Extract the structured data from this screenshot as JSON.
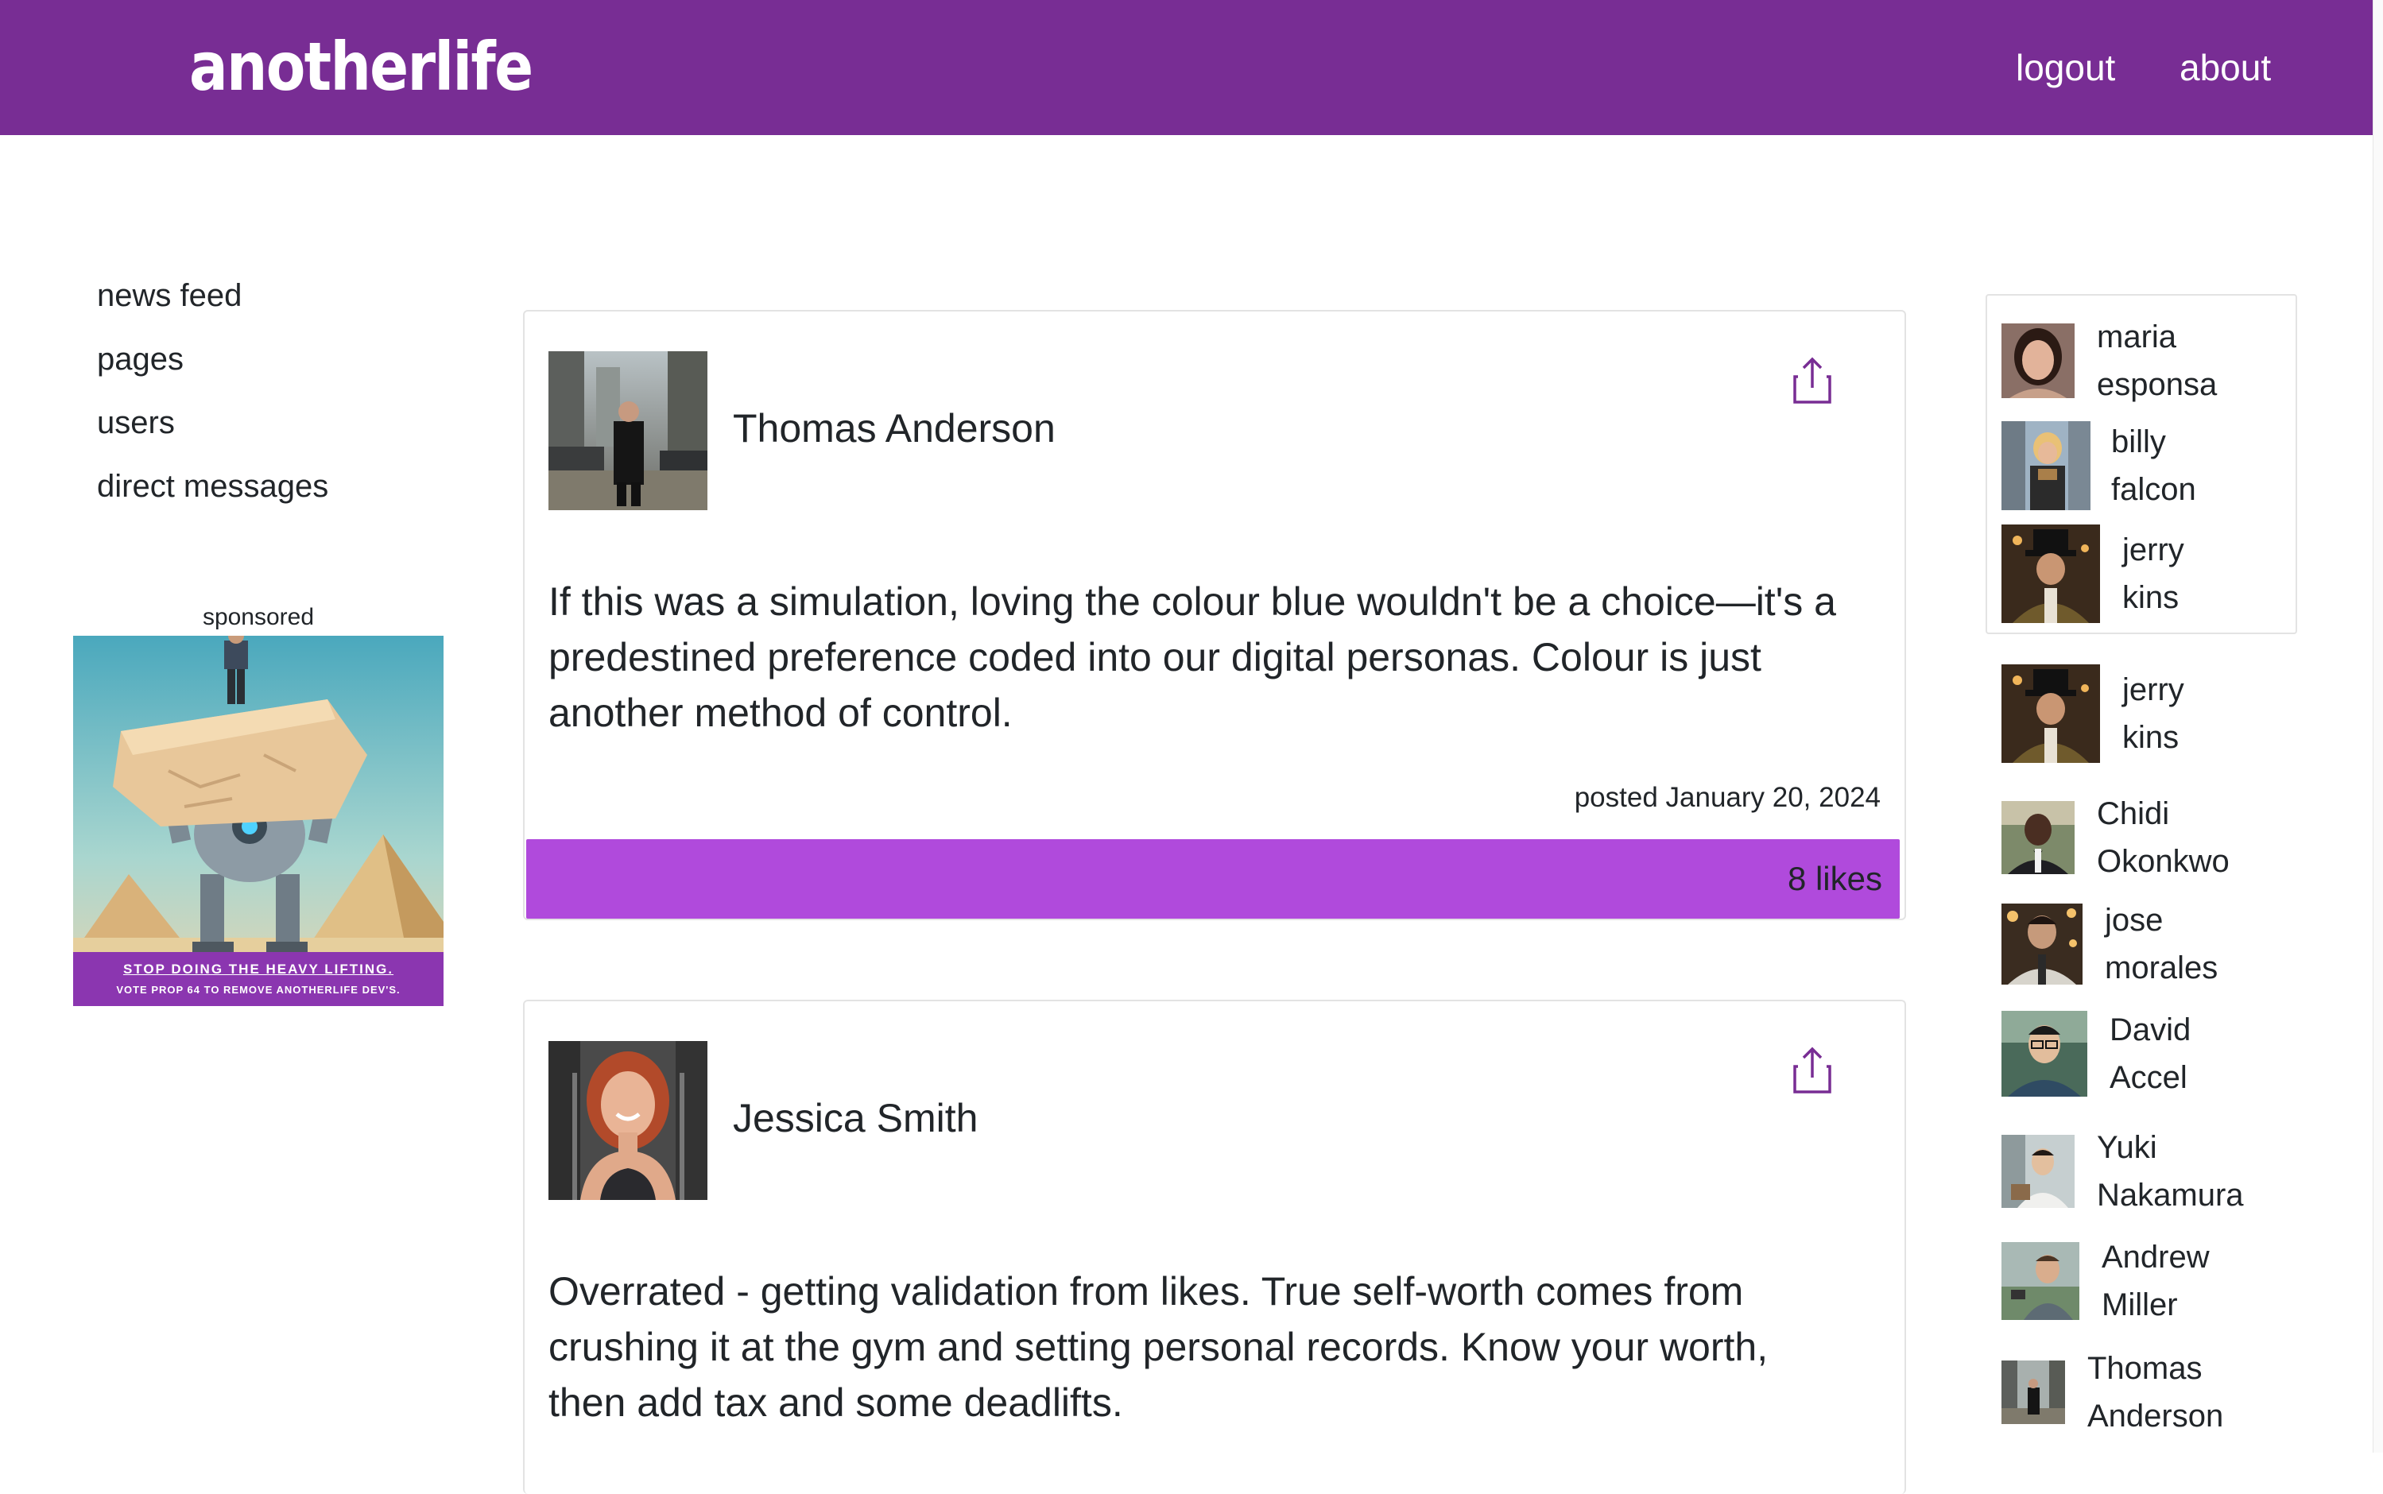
{
  "header": {
    "brand": "anotherlife",
    "logout_label": "logout",
    "about_label": "about",
    "color": "#782d94"
  },
  "sidebar": {
    "items": [
      {
        "label": "news feed"
      },
      {
        "label": "pages"
      },
      {
        "label": "users"
      },
      {
        "label": "direct messages"
      }
    ],
    "sponsored_label": "sponsored",
    "ad": {
      "line1": "STOP DOING THE HEAVY LIFTING.",
      "line2": "VOTE PROP 64 TO REMOVE ANOTHERLIFE DEV'S."
    }
  },
  "posts": [
    {
      "author": "Thomas Anderson",
      "text": "If this was a simulation, loving the colour blue wouldn't be a choice—it's a predestined preference coded into our digital personas. Colour is just another method of control.",
      "date": "posted January 20, 2024",
      "likes": "8 likes"
    },
    {
      "author": "Jessica Smith",
      "text": "Overrated - getting validation from likes. True self-worth comes from crushing it at the gym and setting personal records. Know your worth, then add tax and some deadlifts."
    }
  ],
  "users_online": [
    {
      "first": "maria",
      "last": "esponsa"
    },
    {
      "first": "billy",
      "last": "falcon"
    },
    {
      "first": "jerry",
      "last": "kins"
    }
  ],
  "users": [
    {
      "first": "jerry",
      "last": "kins"
    },
    {
      "first": "Chidi",
      "last": "Okonkwo"
    },
    {
      "first": "jose",
      "last": "morales"
    },
    {
      "first": "David",
      "last": "Accel"
    },
    {
      "first": "Yuki",
      "last": "Nakamura"
    },
    {
      "first": "Andrew",
      "last": "Miller"
    },
    {
      "first": "Thomas",
      "last": "Anderson"
    }
  ],
  "accent_colors": {
    "header": "#782d94",
    "likes_bar": "#b04adc",
    "share_icon": "#782d94"
  }
}
